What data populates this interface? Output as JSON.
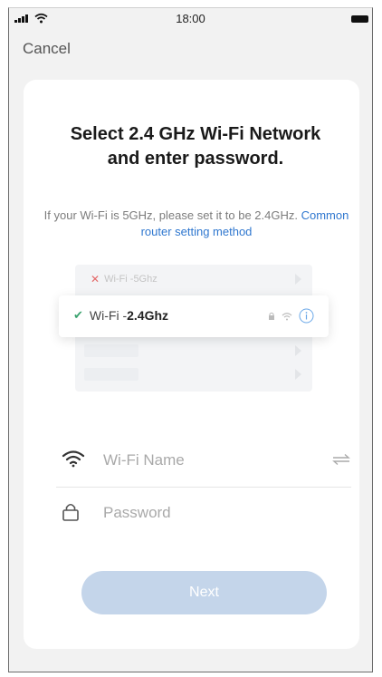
{
  "status_bar": {
    "time": "18:00"
  },
  "nav": {
    "cancel_label": "Cancel"
  },
  "card": {
    "title": "Select 2.4 GHz Wi-Fi Network and enter password.",
    "subtitle_text": "If your Wi-Fi is 5GHz, please set it to be 2.4GHz.",
    "subtitle_link": "Common router setting method"
  },
  "illustration": {
    "row_5g": {
      "prefix": "Wi-Fi - ",
      "band": "5Ghz",
      "status_icon": "cross-icon"
    },
    "row_24g": {
      "prefix": "Wi-Fi - ",
      "band": "2.4Ghz",
      "status_icon": "check-icon"
    }
  },
  "form": {
    "wifi_name_placeholder": "Wi-Fi Name",
    "password_placeholder": "Password",
    "next_label": "Next"
  },
  "colors": {
    "link": "#2f77cf",
    "next_button": "#c4d5ea",
    "check": "#3aa26e",
    "cross": "#e46a6a"
  }
}
